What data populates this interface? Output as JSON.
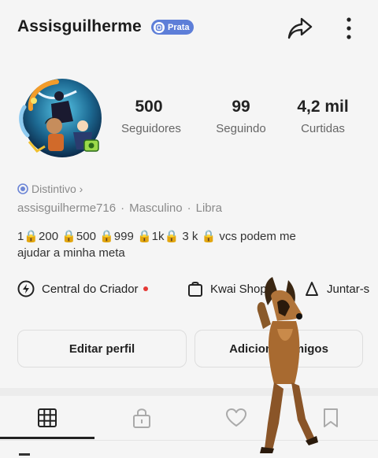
{
  "header": {
    "username": "Assisguilherme",
    "badge_label": "Prata",
    "share_icon": "share-arrow-icon",
    "more_icon": "more-vertical-icon"
  },
  "stats": [
    {
      "value": "500",
      "label": "Seguidores"
    },
    {
      "value": "99",
      "label": "Seguindo"
    },
    {
      "value": "4,2 mil",
      "label": "Curtidas"
    }
  ],
  "profile": {
    "distintivo": "Distintivo ›",
    "handle": "assisguilherme716",
    "gender": "Masculino",
    "sign": "Libra",
    "separator": "·",
    "bio_line1": "1🔒200 🔒500 🔒999 🔒1k🔒 3 k 🔒 vcs podem me",
    "bio_line2": "ajudar a minha meta"
  },
  "actions": {
    "creator_center": "Central do Criador",
    "kwai_shop": "Kwai Shop",
    "join": "Juntar-s"
  },
  "buttons": {
    "edit_profile": "Editar perfil",
    "add_friends": "Adicionar amigos"
  },
  "colors": {
    "badge": "#5d7ed8",
    "notification_dot": "#e53935",
    "background": "#f5f5f5"
  },
  "tabs": [
    "grid-icon",
    "lock-icon",
    "heart-icon",
    "bookmark-icon"
  ]
}
